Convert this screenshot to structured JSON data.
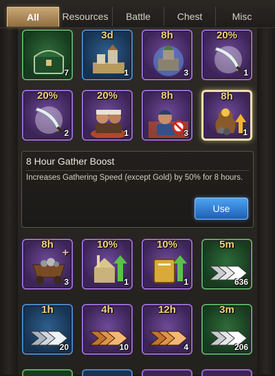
{
  "tabs": [
    "All",
    "Resources",
    "Battle",
    "Chest",
    "Misc"
  ],
  "active_tab": "All",
  "rows": [
    [
      {
        "label": "",
        "count": "7",
        "icon": "chest-icon",
        "color": "green"
      },
      {
        "label": "3d",
        "count": "1",
        "icon": "city-map-icon",
        "color": "blue"
      },
      {
        "label": "8h",
        "count": "3",
        "icon": "fortress-icon",
        "color": "purple"
      },
      {
        "label": "20%",
        "count": "1",
        "icon": "scimitar-icon",
        "color": "purple"
      }
    ],
    [
      {
        "label": "20%",
        "count": "2",
        "icon": "scimitar-icon",
        "color": "purple"
      },
      {
        "label": "20%",
        "count": "1",
        "icon": "warriors-icon",
        "color": "purple"
      },
      {
        "label": "8h",
        "count": "3",
        "icon": "soldier-no-entry-icon",
        "color": "purple"
      },
      {
        "label": "8h",
        "count": "1",
        "icon": "gold-sack-icon",
        "color": "purple",
        "selected": true
      }
    ],
    [
      {
        "label": "8h",
        "count": "3",
        "icon": "ore-cart-icon",
        "color": "purple",
        "plus": "+"
      },
      {
        "label": "10%",
        "count": "1",
        "icon": "building-upgrade-icon",
        "color": "purple"
      },
      {
        "label": "10%",
        "count": "1",
        "icon": "book-upgrade-icon",
        "color": "purple"
      },
      {
        "label": "5m",
        "count": "636",
        "icon": "speedup-arrows-icon",
        "color": "green"
      }
    ],
    [
      {
        "label": "1h",
        "count": "20",
        "icon": "speedup-arrows-icon",
        "color": "blue"
      },
      {
        "label": "4h",
        "count": "10",
        "icon": "speedup-arrows-icon",
        "color": "purple"
      },
      {
        "label": "12h",
        "count": "4",
        "icon": "speedup-arrows-icon",
        "color": "purple"
      },
      {
        "label": "3m",
        "count": "206",
        "icon": "speedup-arrows-icon",
        "color": "green"
      }
    ]
  ],
  "detail": {
    "title": "8 Hour Gather Boost",
    "description": "Increases Gathering Speed (except Gold) by 50% for 8 hours.",
    "button_label": "Use"
  },
  "colors": {
    "accent_tab": "#c9a774",
    "label_gold": "#f4d27a",
    "use_button": "#2f7fd6"
  }
}
